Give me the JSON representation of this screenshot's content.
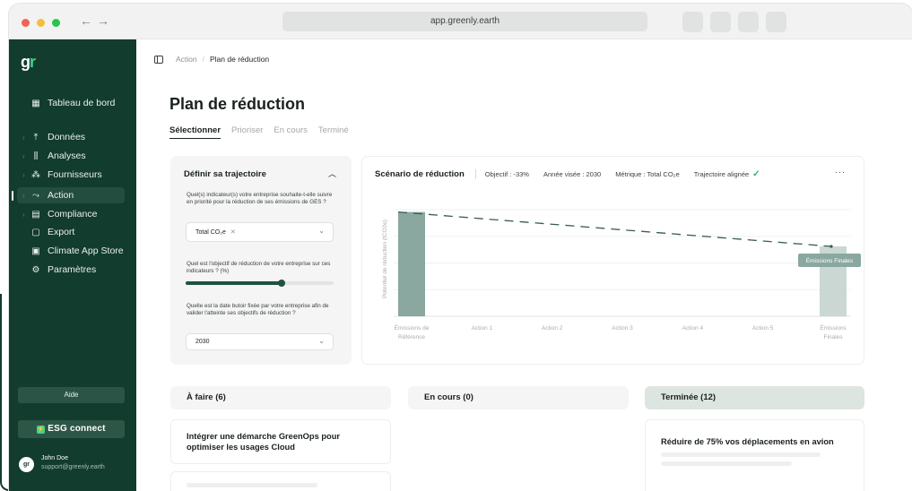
{
  "browser": {
    "url": "app.greenly.earth"
  },
  "sidebar": {
    "logo": "gr",
    "items": [
      {
        "label": "Tableau de bord",
        "icon": "grid-icon"
      },
      {
        "label": "Données",
        "icon": "upload-icon"
      },
      {
        "label": "Analyses",
        "icon": "chart-icon"
      },
      {
        "label": "Fournisseurs",
        "icon": "suppliers-icon"
      },
      {
        "label": "Action",
        "icon": "trend-icon"
      },
      {
        "label": "Compliance",
        "icon": "document-icon"
      },
      {
        "label": "Export",
        "icon": "file-icon"
      },
      {
        "label": "Climate App Store",
        "icon": "store-icon"
      },
      {
        "label": "Paramètres",
        "icon": "gear-icon"
      }
    ],
    "help_label": "Aide",
    "esg_label": "ESG connect",
    "user": {
      "avatar": "gr",
      "name": "John Doe",
      "email": "support@greenly.earth"
    }
  },
  "breadcrumb": {
    "parent": "Action",
    "current": "Plan de réduction"
  },
  "page": {
    "title": "Plan de réduction",
    "tabs": [
      "Sélectionner",
      "Prioriser",
      "En cours",
      "Terminé"
    ]
  },
  "config": {
    "title": "Définir sa trajectoire",
    "question1": "Quel(s) indicateur(s) votre entreprise souhaite-t-elle suivre en priorité pour la réduction de ses émissions de GES ?",
    "indicator_value": "Total CO₂e",
    "question2": "Quel est l'objectif de réduction de votre entreprise sur ces indicateurs ? (%)",
    "slider_fraction": 0.65,
    "question3": "Quelle est la date butoir fixée par votre entreprise afin de valider l'atteinte ses objectifs de réduction ?",
    "year_value": "2030"
  },
  "scenario": {
    "title": "Scénario de réduction",
    "objective": "Objectif : -33%",
    "year": "Année visée : 2030",
    "metric": "Métrique : Total CO₂e",
    "trajectory": "Trajectoire alignée",
    "colors": {
      "bar": "#8aa89f",
      "final_bar": "#cad7d2",
      "line": "#375c4f",
      "tooltip": "#8aa89f"
    }
  },
  "chart_data": {
    "type": "bar",
    "ylabel": "Potentiel de réduction (tCO2e)",
    "categories": [
      "Émissions de Référence",
      "Action 1",
      "Action 2",
      "Action 3",
      "Action 4",
      "Action 5",
      "Émissions Finales"
    ],
    "values": [
      100,
      0,
      0,
      0,
      0,
      0,
      67
    ],
    "ylim": [
      0,
      110
    ],
    "trajectory_line": {
      "from": 100,
      "to": 67
    },
    "annotation": "Émissions Finales"
  },
  "kanban": {
    "todo": {
      "label": "À faire (6)",
      "card": "Intégrer une démarche GreenOps pour optimiser les usages Cloud"
    },
    "in_progress": {
      "label": "En cours (0)"
    },
    "done": {
      "label": "Terminée (12)",
      "card": "Réduire de 75% vos déplacements en avion"
    }
  }
}
